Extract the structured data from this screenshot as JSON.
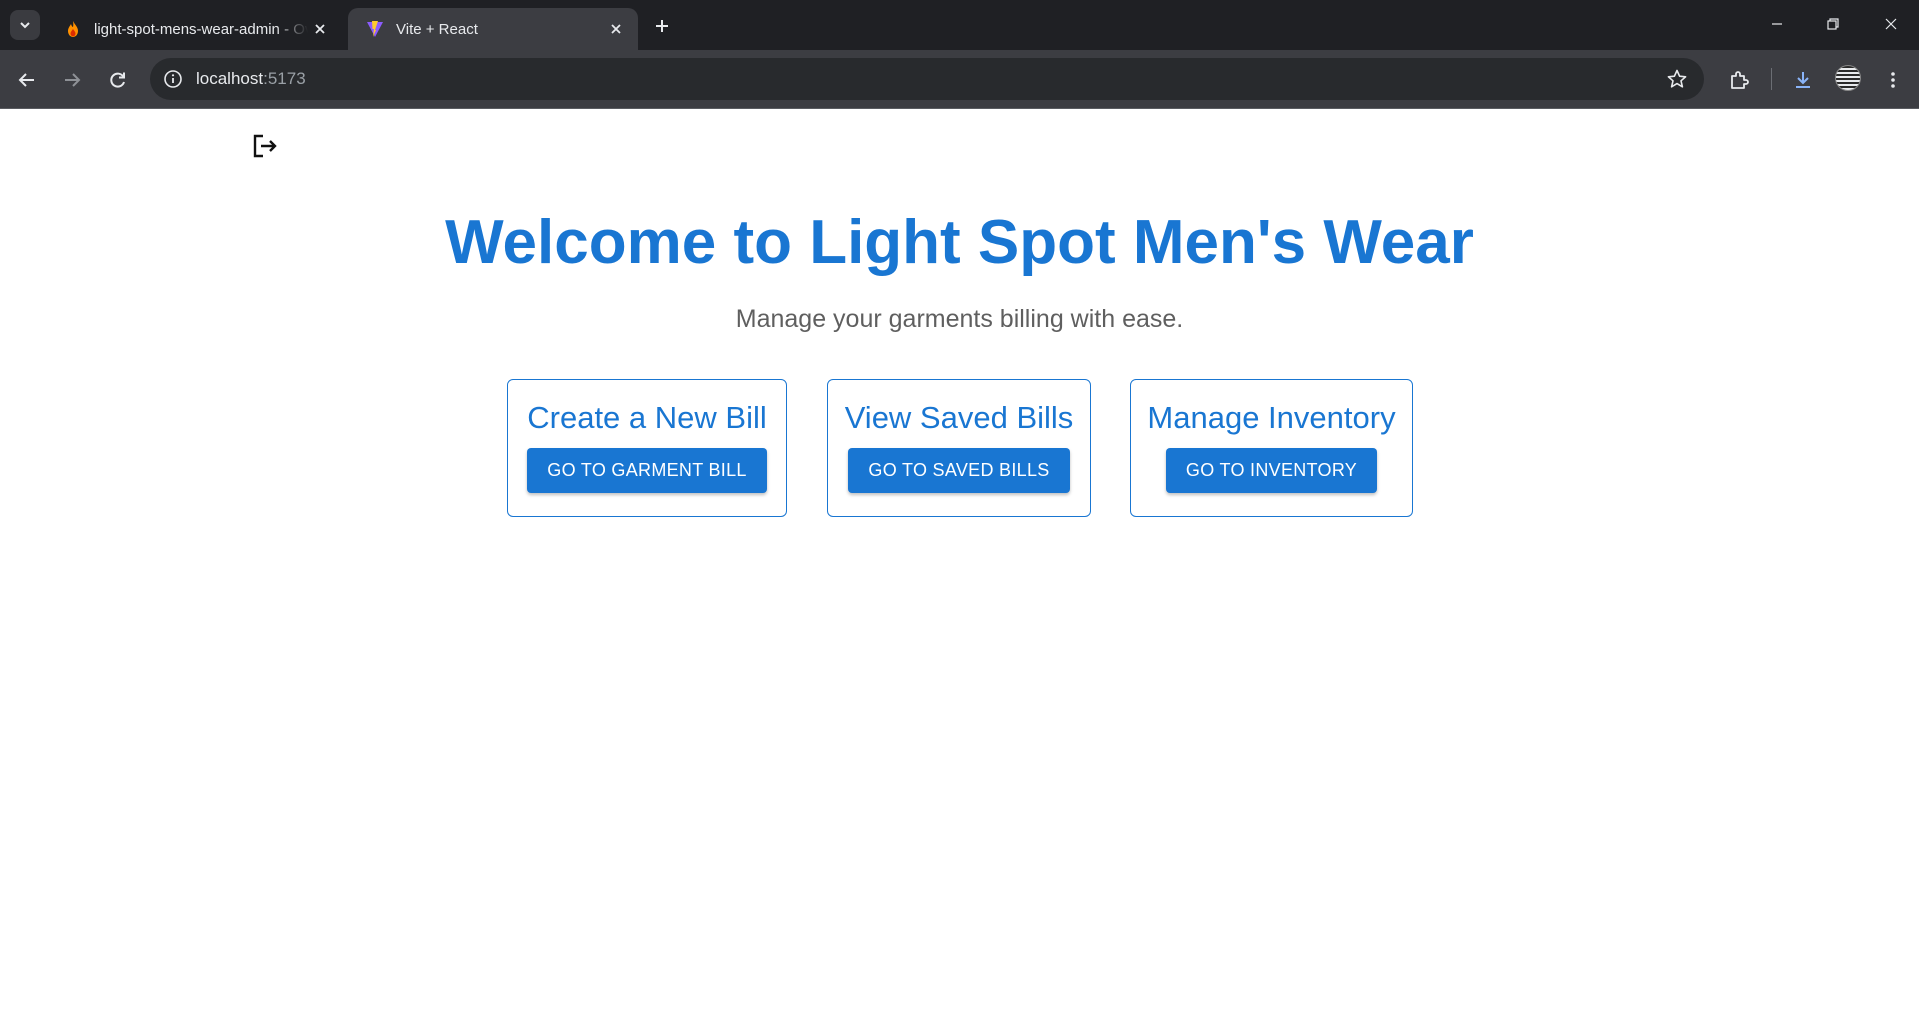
{
  "browser": {
    "tabs": [
      {
        "title": "light-spot-mens-wear-admin - Overview - Firebase console",
        "favicon": "firebase-icon",
        "active": false
      },
      {
        "title": "Vite + React",
        "favicon": "vite-icon",
        "active": true
      }
    ],
    "address": {
      "host": "localhost",
      "port": ":5173"
    }
  },
  "page": {
    "heading": "Welcome to Light Spot Men's Wear",
    "subheading": "Manage your garments billing with ease.",
    "cards": [
      {
        "title": "Create a New Bill",
        "button": "GO TO GARMENT BILL"
      },
      {
        "title": "View Saved Bills",
        "button": "GO TO SAVED BILLS"
      },
      {
        "title": "Manage Inventory",
        "button": "GO TO INVENTORY"
      }
    ]
  },
  "colors": {
    "primary": "#1976d2",
    "subtext": "#5f5f5f",
    "chrome_dark": "#1f2024",
    "chrome_toolbar": "#3c3d42"
  }
}
